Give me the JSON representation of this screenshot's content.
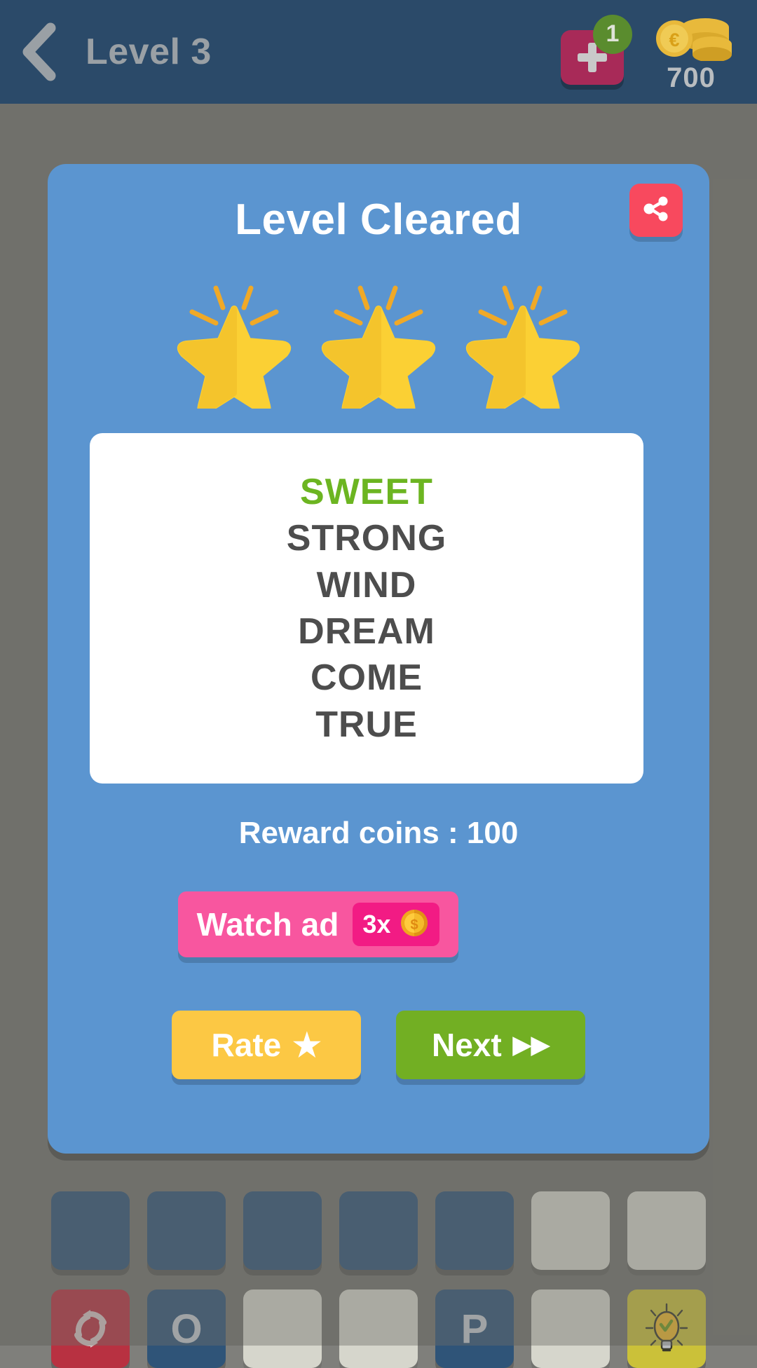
{
  "header": {
    "back_icon": "chevron-left-icon",
    "title": "Level 3",
    "add_button_icon": "plus-icon",
    "add_badge_count": "1",
    "coin_icon": "coin-stack-icon",
    "coin_amount": "700",
    "bg_color": "#2b4a69",
    "title_color": "#9aa0a5"
  },
  "dialog": {
    "title": "Level Cleared",
    "share_icon": "share-icon",
    "share_color": "#f8495e",
    "card_color": "#5b95d0",
    "stars_earned": 3,
    "stars_total": 3,
    "star_icon": "star-icon",
    "words": [
      {
        "text": "SWEET",
        "solved": true
      },
      {
        "text": "STRONG",
        "solved": false
      },
      {
        "text": "WIND",
        "solved": false
      },
      {
        "text": "DREAM",
        "solved": false
      },
      {
        "text": "COME",
        "solved": false
      },
      {
        "text": "TRUE",
        "solved": false
      }
    ],
    "solved_color": "#6cb521",
    "word_color": "#4d4d4d",
    "reward_label": "Reward coins : 100",
    "watch_ad": {
      "label": "Watch ad",
      "multiplier": "3x",
      "coin_icon": "dollar-coin-icon",
      "color": "#f8569f",
      "pill_color": "#f21b84"
    },
    "actions": [
      {
        "label": "Rate",
        "icon": "star-glyph",
        "glyph": "★",
        "color": "#fcc844",
        "name": "rate-button"
      },
      {
        "label": "Next",
        "icon": "fast-forward-glyph",
        "glyph": "▶▶",
        "color": "#72af23",
        "name": "next-button"
      }
    ]
  },
  "board": {
    "top_row": [
      {
        "type": "letter",
        "label": ""
      },
      {
        "type": "letter",
        "label": ""
      },
      {
        "type": "letter",
        "label": ""
      },
      {
        "type": "letter",
        "label": ""
      },
      {
        "type": "letter",
        "label": ""
      },
      {
        "type": "blank",
        "label": ""
      },
      {
        "type": "blank",
        "label": ""
      }
    ],
    "bottom_row": [
      {
        "type": "shuffle",
        "label": "",
        "icon": "shuffle-icon"
      },
      {
        "type": "letter",
        "label": "O"
      },
      {
        "type": "blank",
        "label": ""
      },
      {
        "type": "blank",
        "label": ""
      },
      {
        "type": "letter",
        "label": "P"
      },
      {
        "type": "blank",
        "label": ""
      },
      {
        "type": "hint",
        "label": "",
        "icon": "lightbulb-icon"
      }
    ]
  }
}
